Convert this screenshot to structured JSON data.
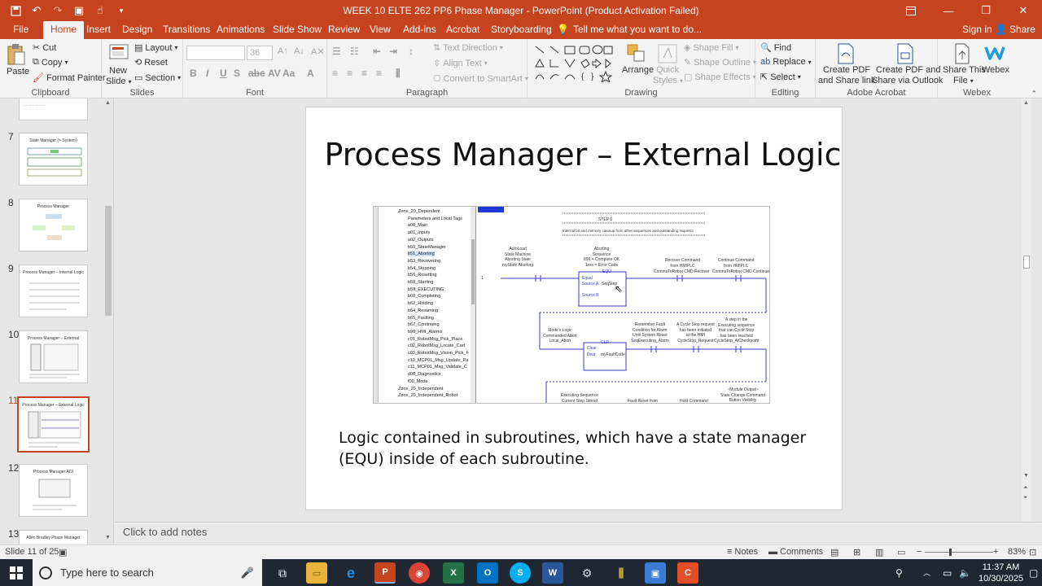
{
  "window": {
    "title": "WEEK 10 ELTE 262 PP6 Phase Manager - PowerPoint (Product Activation Failed)"
  },
  "tabs": [
    "File",
    "Home",
    "Insert",
    "Design",
    "Transitions",
    "Animations",
    "Slide Show",
    "Review",
    "View",
    "Add-ins",
    "Acrobat",
    "Storyboarding"
  ],
  "tell_me": "Tell me what you want to do...",
  "sign_in": "Sign in",
  "share": "Share",
  "ribbon": {
    "clipboard": {
      "label": "Clipboard",
      "paste": "Paste",
      "cut": "Cut",
      "copy": "Copy",
      "format_painter": "Format Painter"
    },
    "slides": {
      "label": "Slides",
      "new_slide_1": "New",
      "new_slide_2": "Slide",
      "layout": "Layout",
      "reset": "Reset",
      "section": "Section"
    },
    "font": {
      "label": "Font",
      "size": "36"
    },
    "paragraph": {
      "label": "Paragraph",
      "text_direction": "Text Direction",
      "align_text": "Align Text",
      "smartart": "Convert to SmartArt"
    },
    "drawing": {
      "label": "Drawing",
      "arrange": "Arrange",
      "quick_styles_1": "Quick",
      "quick_styles_2": "Styles",
      "shape_fill": "Shape Fill",
      "shape_outline": "Shape Outline",
      "shape_effects": "Shape Effects"
    },
    "editing": {
      "label": "Editing",
      "find": "Find",
      "replace": "Replace",
      "select": "Select"
    },
    "acrobat": {
      "label": "Adobe Acrobat",
      "create_pdf_1": "Create PDF",
      "create_pdf_2": "and Share link",
      "create_outlook_1": "Create PDF and",
      "create_outlook_2": "Share via Outlook"
    },
    "webex": {
      "label": "Webex",
      "share_file_1": "Share This",
      "share_file_2": "File",
      "webex": "Webex"
    }
  },
  "thumbnails": [
    {
      "num": "7",
      "title": "State Manager (= System)"
    },
    {
      "num": "8",
      "title": "Process Manager"
    },
    {
      "num": "9",
      "title": "Process Manager – Internal Logic"
    },
    {
      "num": "10",
      "title": "Process Manager – External"
    },
    {
      "num": "11",
      "title": "Process Manager – External Logic"
    },
    {
      "num": "12",
      "title": "Process Manager AOI"
    },
    {
      "num": "13",
      "title": "Allen Bradley Phase Manager"
    }
  ],
  "slide": {
    "title": "Process Manager – External Logic",
    "body": "Logic contained in subroutines, which have a state manager (EQU) inside of each subroutine."
  },
  "tree_items": [
    "Zone_20_Dependent",
    "Parameters and Local Tags",
    "a00_Main",
    "a01_Inputs",
    "a02_Outputs",
    "b50_StateManager",
    "b51_Aborting",
    "b53_Recovering",
    "b54_Stopping",
    "b56_Resetting",
    "b58_Starting",
    "b59_EXECUTING",
    "b60_Completing",
    "b62_Holding",
    "b64_Resuming",
    "b65_Faulting",
    "b67_Continuing",
    "b90_HMI_Alarms",
    "c01_RobotMsg_Pick_Place",
    "c02_RobotMsg_Locate_Cart",
    "c03_RobotMsg_Vision_Pick_F",
    "c10_MCP01_Msg_Update_Pa",
    "c11_MCP01_Msg_Validate_C",
    "d00_Diagnostics",
    "f00_Mode",
    "Zone_20_Independent",
    "Zone_20_Independent_Robot"
  ],
  "ladder": {
    "step": "STEP 0",
    "step_desc": "Internal bit and memory cleanup from other sequences and outstanding requests",
    "rung_num": "1",
    "autoload": "AutoLoad\nState Machine\nAborting State\nmyState Aborting",
    "aborting": "Aborting\nSequence\n899 = Complete OK\n1xxx = Error Code",
    "equ": "EQU",
    "equal": "Equal",
    "source_a": "Source A",
    "source_b": "Source B",
    "seqstep": "SeqStep",
    "recover": "Recover Command\nfrom HMIPLC",
    "continue": "Continue Command\nfrom HMIPLC",
    "commstorobot_recover": "CommsToRobot CMD Recover",
    "commstorobot_continue": "CommsToRobot CMD Continue",
    "mode_logic": "Mode's Logic\nCommanded Abort\nLocal_Abort",
    "clr": "CLR",
    "clear": "Clear",
    "dest": "Dest",
    "myfaultcode": "myFaultCode",
    "remember": "Remember Fault\nCondition for Alarm\nUntil System Reset\nSeqExecuting_Alarm",
    "cycle_stop": "A Cycle Stop request\nhas been initiated\nat the HMI\nCycleStop_Request",
    "step_in": "A step in the\nExecuting sequence\nthat can Cycle Stop\nhas been reached\nCycleStop_AtCheckpoint",
    "executing": "Executing Sequence\nCurrent Step Stored",
    "fault_reset": "Fault Reset from",
    "hold_command": "Hold Command",
    "module_output": "~Module Output~\nState Change Command\nButton Visibility"
  },
  "notes_placeholder": "Click to add notes",
  "status": {
    "slide": "Slide 11 of 25",
    "notes": "Notes",
    "comments": "Comments",
    "zoom": "83%"
  },
  "taskbar": {
    "search_placeholder": "Type here to search",
    "time": "11:37 AM",
    "date": "10/30/2025"
  },
  "colors": {
    "accent": "#c5441f",
    "ladder_blue": "#3b3bc8"
  }
}
